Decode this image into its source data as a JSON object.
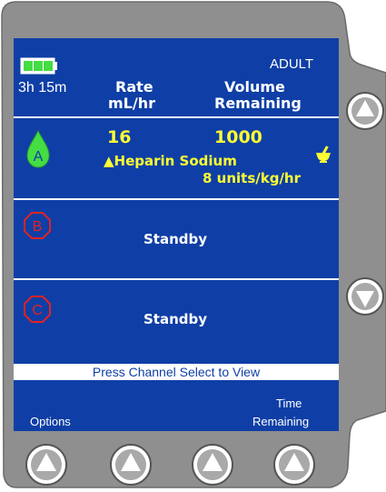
{
  "header": {
    "mode": "ADULT",
    "battery_time": "3h 15m",
    "col_rate_line1": "Rate",
    "col_rate_line2": "mL/hr",
    "col_volume_line1": "Volume",
    "col_volume_line2": "Remaining"
  },
  "channels": [
    {
      "letter": "A",
      "rate": "16",
      "volume": "1000",
      "drug": "▲Heparin Sodium",
      "dose": "8 units/kg/hr"
    },
    {
      "letter": "B",
      "status": "Standby"
    },
    {
      "letter": "C",
      "status": "Standby"
    }
  ],
  "banner": "Press Channel Select to View",
  "softkeys": {
    "left": "Options",
    "right_line1": "Time",
    "right_line2": "Remaining"
  },
  "colors": {
    "screen": "#0f3fa6",
    "bezel": "#8f8f8f",
    "accent_yellow": "#ffff33",
    "channel_a_drop": "#44dd44",
    "inactive_channel": "#e22222",
    "battery": "#44dd44"
  },
  "icons": {
    "battery": "battery-icon",
    "drop": "drop-icon",
    "mortar": "mortar-pestle-icon",
    "up": "up-arrow-icon",
    "down": "down-arrow-icon"
  }
}
